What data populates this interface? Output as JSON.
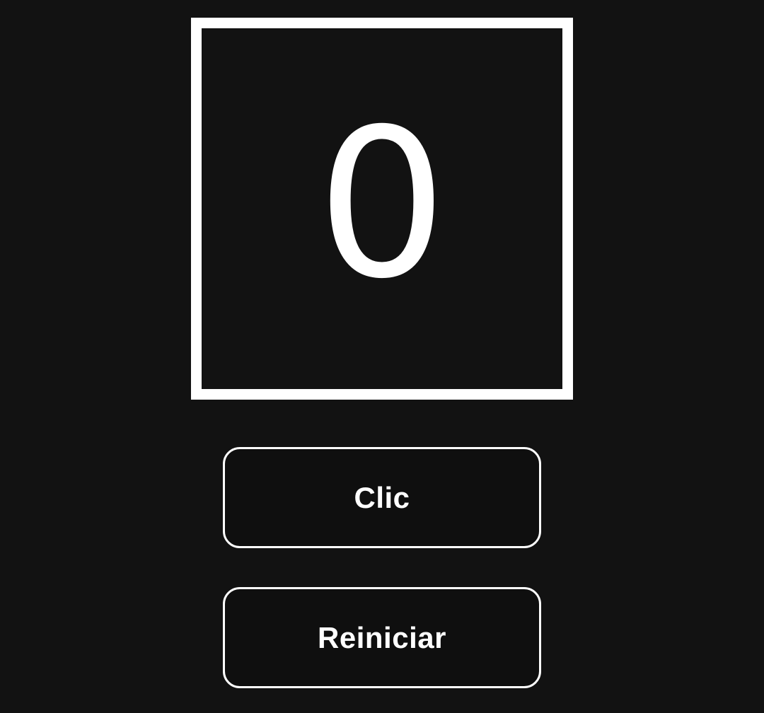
{
  "counter": {
    "value": "0"
  },
  "buttons": {
    "click_label": "Clic",
    "reset_label": "Reiniciar"
  },
  "colors": {
    "background": "#121212",
    "foreground": "#ffffff",
    "button_background": "#0f0f0f"
  }
}
